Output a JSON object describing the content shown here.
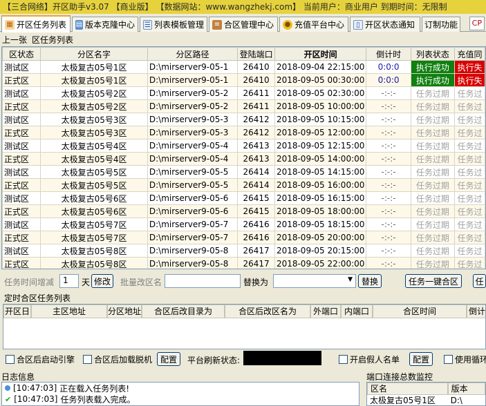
{
  "window": {
    "title": "【三合网络】开区助手v3.07  【商业版】  【数据网站：www.wangzhekj.com】  当前用户：商业用户  到期时间：无限制"
  },
  "tabs": [
    {
      "label": "开区任务列表",
      "icon": "calendar-icon",
      "active": true
    },
    {
      "label": "版本克隆中心",
      "icon": "folder-icon",
      "active": false
    },
    {
      "label": "列表模板管理",
      "icon": "list-icon",
      "active": false
    },
    {
      "label": "合区管理中心",
      "icon": "merge-icon",
      "active": false
    },
    {
      "label": "充值平台中心",
      "icon": "coin-icon",
      "active": false
    },
    {
      "label": "开区状态通知",
      "icon": "doc-icon",
      "active": false
    },
    {
      "label": "订制功能",
      "icon": "",
      "active": false
    }
  ],
  "corner_label": "CP",
  "subbar": {
    "prev": "上一张",
    "list_label": "区任务列表"
  },
  "task_table": {
    "headers": [
      "区状态",
      "分区名字",
      "分区路径",
      "登陆端口",
      "开区时间",
      "倒计时",
      "列表状态",
      "充值同"
    ],
    "rows": [
      {
        "type": "测试区",
        "name": "太极复古05号1区",
        "path": "D:\\mirserver9-05-1",
        "port": "26410",
        "time": "2018-09-04 22:15:00",
        "countdown": "0:0:0",
        "list_status": "执行成功",
        "recharge": "执行失"
      },
      {
        "type": "正式区",
        "name": "太极复古05号1区",
        "path": "D:\\mirserver9-05-1",
        "port": "26410",
        "time": "2018-09-05 00:30:00",
        "countdown": "0:0:0",
        "list_status": "执行成功",
        "recharge": "执行失"
      },
      {
        "type": "测试区",
        "name": "太极复古05号2区",
        "path": "D:\\mirserver9-05-2",
        "port": "26411",
        "time": "2018-09-05 02:30:00",
        "countdown": "-:-:-",
        "list_status": "任务过期",
        "recharge": "任务过"
      },
      {
        "type": "正式区",
        "name": "太极复古05号2区",
        "path": "D:\\mirserver9-05-2",
        "port": "26411",
        "time": "2018-09-05 10:00:00",
        "countdown": "-:-:-",
        "list_status": "任务过期",
        "recharge": "任务过"
      },
      {
        "type": "测试区",
        "name": "太极复古05号3区",
        "path": "D:\\mirserver9-05-3",
        "port": "26412",
        "time": "2018-09-05 10:15:00",
        "countdown": "-:-:-",
        "list_status": "任务过期",
        "recharge": "任务过"
      },
      {
        "type": "正式区",
        "name": "太极复古05号3区",
        "path": "D:\\mirserver9-05-3",
        "port": "26412",
        "time": "2018-09-05 12:00:00",
        "countdown": "-:-:-",
        "list_status": "任务过期",
        "recharge": "任务过"
      },
      {
        "type": "测试区",
        "name": "太极复古05号4区",
        "path": "D:\\mirserver9-05-4",
        "port": "26413",
        "time": "2018-09-05 12:15:00",
        "countdown": "-:-:-",
        "list_status": "任务过期",
        "recharge": "任务过"
      },
      {
        "type": "正式区",
        "name": "太极复古05号4区",
        "path": "D:\\mirserver9-05-4",
        "port": "26413",
        "time": "2018-09-05 14:00:00",
        "countdown": "-:-:-",
        "list_status": "任务过期",
        "recharge": "任务过"
      },
      {
        "type": "测试区",
        "name": "太极复古05号5区",
        "path": "D:\\mirserver9-05-5",
        "port": "26414",
        "time": "2018-09-05 14:15:00",
        "countdown": "-:-:-",
        "list_status": "任务过期",
        "recharge": "任务过"
      },
      {
        "type": "正式区",
        "name": "太极复古05号5区",
        "path": "D:\\mirserver9-05-5",
        "port": "26414",
        "time": "2018-09-05 16:00:00",
        "countdown": "-:-:-",
        "list_status": "任务过期",
        "recharge": "任务过"
      },
      {
        "type": "测试区",
        "name": "太极复古05号6区",
        "path": "D:\\mirserver9-05-6",
        "port": "26415",
        "time": "2018-09-05 16:15:00",
        "countdown": "-:-:-",
        "list_status": "任务过期",
        "recharge": "任务过"
      },
      {
        "type": "正式区",
        "name": "太极复古05号6区",
        "path": "D:\\mirserver9-05-6",
        "port": "26415",
        "time": "2018-09-05 18:00:00",
        "countdown": "-:-:-",
        "list_status": "任务过期",
        "recharge": "任务过"
      },
      {
        "type": "测试区",
        "name": "太极复古05号7区",
        "path": "D:\\mirserver9-05-7",
        "port": "26416",
        "time": "2018-09-05 18:15:00",
        "countdown": "-:-:-",
        "list_status": "任务过期",
        "recharge": "任务过"
      },
      {
        "type": "正式区",
        "name": "太极复古05号7区",
        "path": "D:\\mirserver9-05-7",
        "port": "26416",
        "time": "2018-09-05 20:00:00",
        "countdown": "-:-:-",
        "list_status": "任务过期",
        "recharge": "任务过"
      },
      {
        "type": "测试区",
        "name": "太极复古05号8区",
        "path": "D:\\mirserver9-05-8",
        "port": "26417",
        "time": "2018-09-05 20:15:00",
        "countdown": "-:-:-",
        "list_status": "任务过期",
        "recharge": "任务过"
      },
      {
        "type": "正式区",
        "name": "太极复古05号8区",
        "path": "D:\\mirserver9-05-8",
        "port": "26417",
        "time": "2018-09-05 22:00:00",
        "countdown": "-:-:-",
        "list_status": "任务过期",
        "recharge": "任务过"
      }
    ]
  },
  "controls": {
    "time_add_label": "任务时间增减",
    "time_add_value": "1",
    "day_label": "天",
    "modify_btn": "修改",
    "batch_rename_label": "批量改区名",
    "replace_label": "替换为",
    "replace_btn": "替换",
    "one_click_merge_btn": "任务一键合区",
    "cut_btn": "任"
  },
  "merge_section": {
    "title": "定时合区任务列表",
    "headers": [
      "开区日",
      "主区地址",
      "分区地址",
      "合区后改目录为",
      "合区后改区名为",
      "外端口",
      "内端口",
      "合区时间",
      "倒计"
    ]
  },
  "options": {
    "engine_after_merge": "合区后启动引擎",
    "load_offline_after_merge": "合区后加载脱机",
    "config_btn": "配置",
    "platform_status_label": "平台刷新状态:",
    "fake_list_label": "开启假人名单",
    "config_btn2": "配置",
    "use_loop_label": "使用循环"
  },
  "log": {
    "title": "日志信息",
    "lines": [
      {
        "time": "[10:47:03]",
        "text": "正在载入任务列表!",
        "icon": "info-icon"
      },
      {
        "time": "[10:47:03]",
        "text": "任务列表载入完成。",
        "icon": "check-icon"
      }
    ]
  },
  "monitor": {
    "title": "端口连接总数监控",
    "headers": [
      "区名",
      "版本"
    ],
    "row": [
      "太极复古05号1区",
      "D:\\"
    ]
  },
  "colors": {
    "success": "#108010",
    "failure": "#d80000",
    "expired": "#a0a0a0",
    "title_bar": "#e6d23c",
    "tab_accent": "#f0a030"
  }
}
